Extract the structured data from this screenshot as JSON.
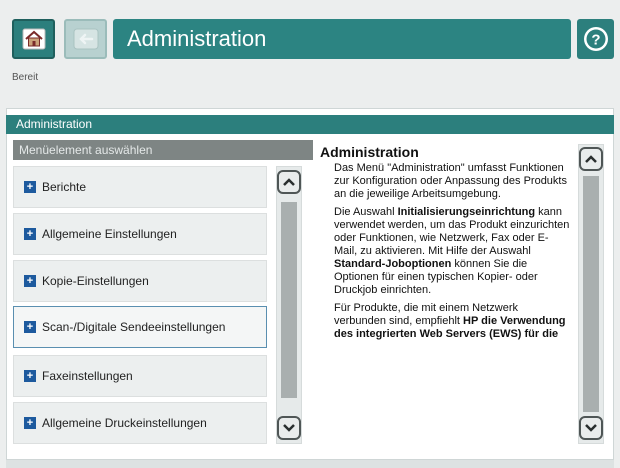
{
  "header": {
    "home_icon": "home-icon",
    "back_icon": "back-arrow-icon",
    "title": "Administration",
    "help_icon": "help-icon"
  },
  "status": "Bereit",
  "panel": {
    "header": "Administration",
    "menu_header": "Menüelement auswählen",
    "items": [
      {
        "label": "Berichte"
      },
      {
        "label": "Allgemeine Einstellungen"
      },
      {
        "label": "Kopie-Einstellungen"
      },
      {
        "label": "Scan-/Digitale Sendeeinstellungen"
      },
      {
        "label": "Faxeinstellungen"
      },
      {
        "label": "Allgemeine Druckeinstellungen"
      }
    ],
    "selected_index": 3
  },
  "description": {
    "title": "Administration",
    "p1": "Das Menü \"Administration\" umfasst Funktionen zur Konfiguration oder Anpassung des Produkts an die jeweilige Arbeitsumgebung.",
    "p2_a": "Die Auswahl ",
    "p2_b": "Initialisierungseinrichtung",
    "p2_c": " kann verwendet werden, um das Produkt einzurichten oder Funktionen, wie Netzwerk, Fax oder E-Mail, zu aktivieren. Mit Hilfe der Auswahl ",
    "p2_d": "Standard-Joboptionen",
    "p2_e": " können Sie die Optionen für einen typischen Kopier- oder Druckjob einrichten.",
    "p3_a": "Für Produkte, die mit einem Netzwerk verbunden sind, empfiehlt ",
    "p3_b": "HP die Verwendung des integrierten Web Servers (EWS) für die",
    "p3_c": ""
  },
  "colors": {
    "teal": "#2c7f7d",
    "teal_light": "#b8d1d0",
    "menu_header": "#7e8584",
    "plus_blue": "#1d5a9e"
  }
}
